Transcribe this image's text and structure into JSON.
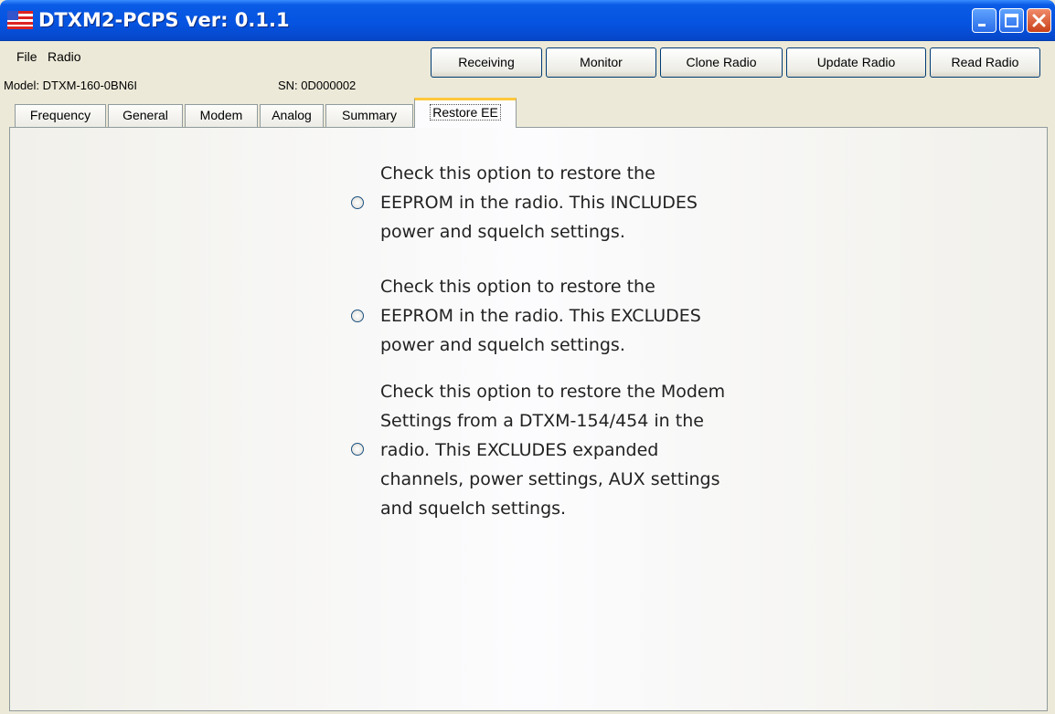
{
  "window": {
    "title": "DTXM2-PCPS ver: 0.1.1"
  },
  "menu": {
    "items": [
      "File",
      "Radio"
    ]
  },
  "toolbar": {
    "buttons": [
      "Receiving",
      "Monitor",
      "Clone Radio",
      "Update Radio",
      "Read Radio"
    ]
  },
  "device": {
    "model": "Model: DTXM-160-0BN6I",
    "sn": "SN: 0D000002"
  },
  "tabs": [
    "Frequency",
    "General",
    "Modem",
    "Analog",
    "Summary",
    "Restore EE"
  ],
  "active_tab": "Restore EE",
  "options": [
    {
      "lines": [
        "Check this option to restore the",
        "EEPROM in the radio. This INCLUDES",
        "power and squelch settings."
      ],
      "checked": false
    },
    {
      "lines": [
        "Check this option to restore the",
        "EEPROM in the radio. This EXCLUDES",
        "power and squelch settings."
      ],
      "checked": false
    },
    {
      "lines": [
        "Check this option to restore the Modem",
        "Settings from a DTXM-154/454 in the",
        "radio. This EXCLUDES expanded",
        "channels, power settings, AUX settings",
        "and squelch settings."
      ],
      "checked": false
    }
  ],
  "colors": {
    "titlebar": "#0553e0",
    "tab_highlight": "#ffc83c",
    "window_bg": "#ece9d8"
  }
}
